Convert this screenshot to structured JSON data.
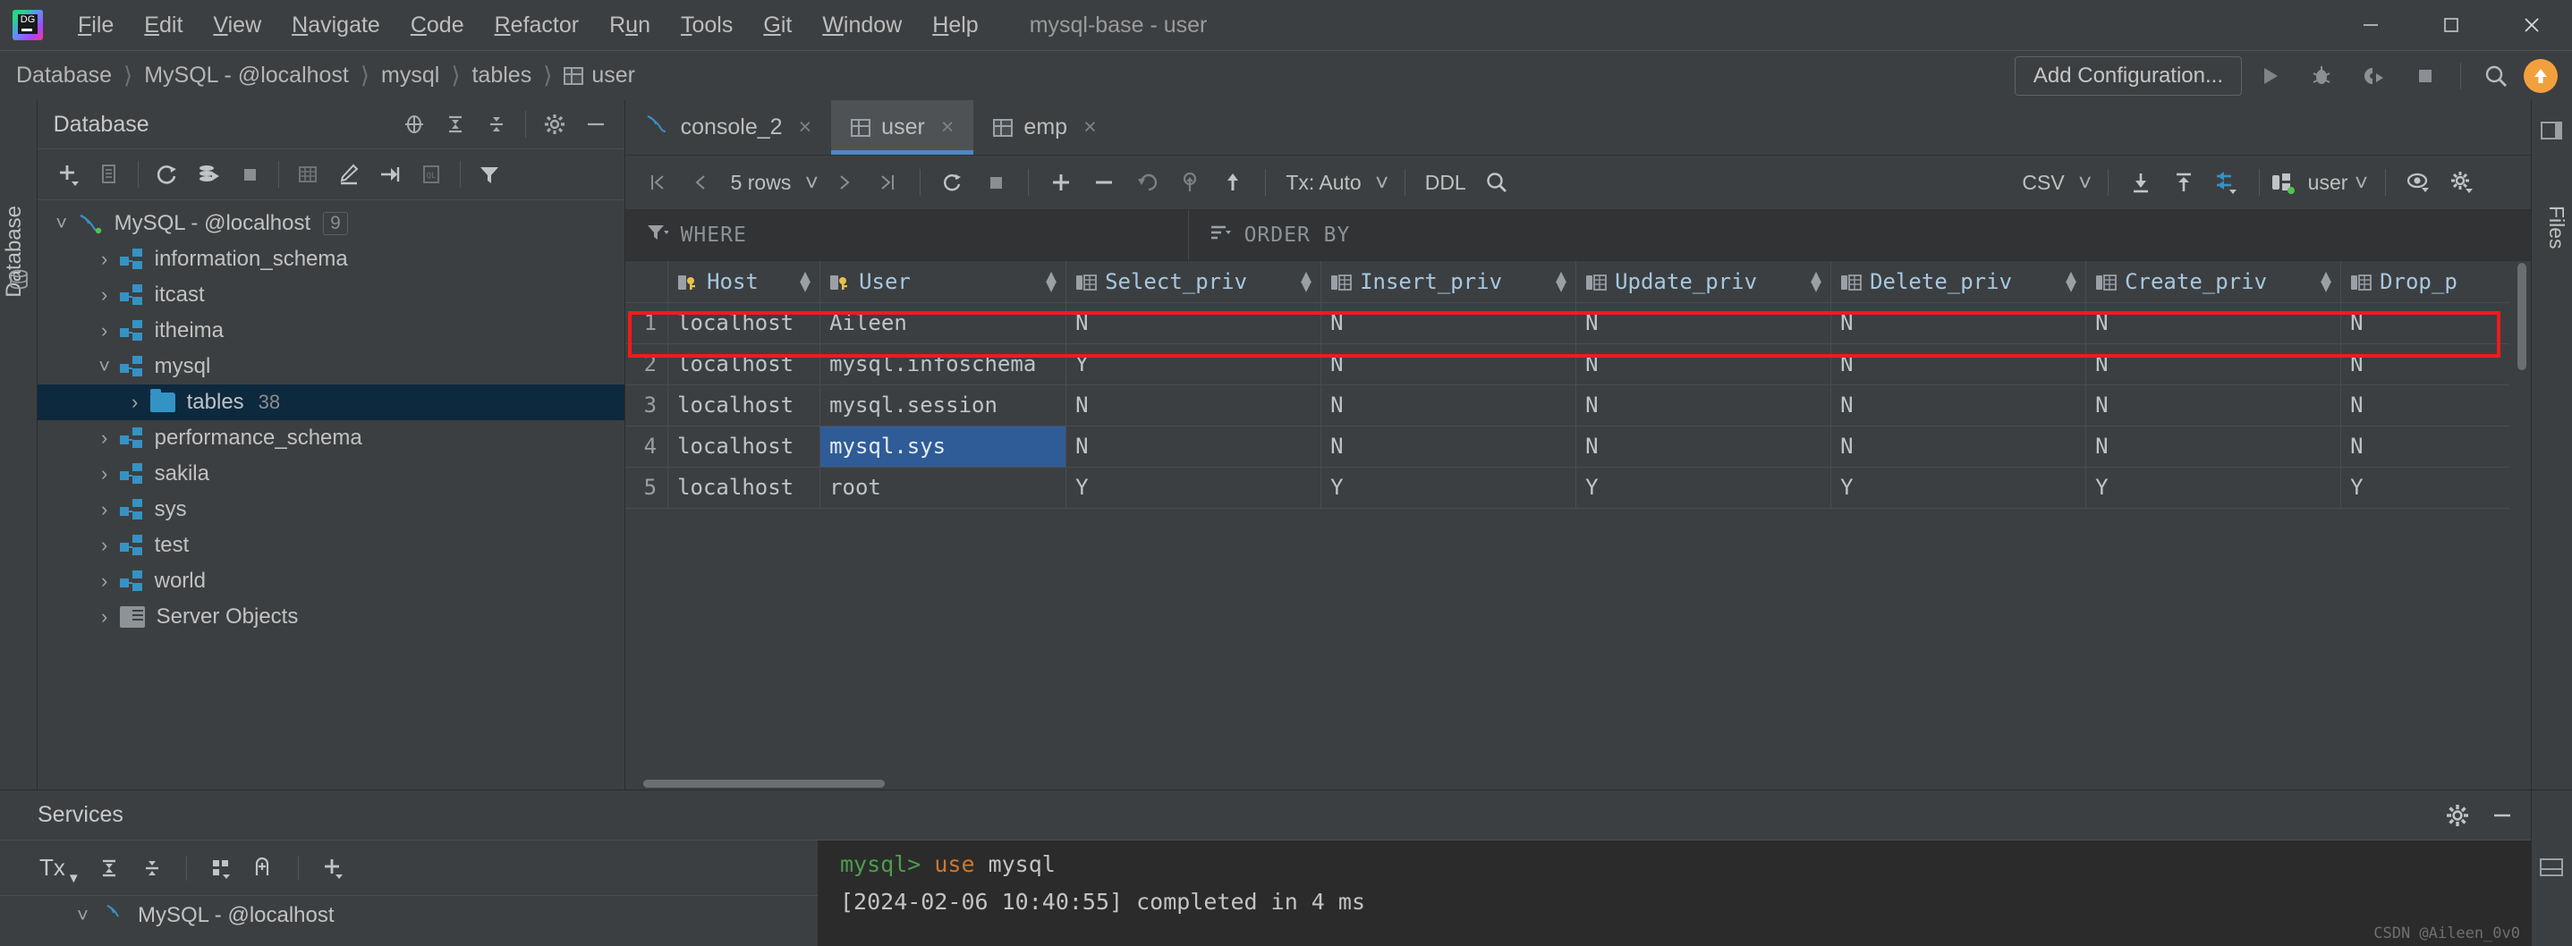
{
  "window": {
    "title": "mysql-base - user",
    "logo_text": "DG",
    "controls": {
      "minimize": "minimize-icon",
      "maximize": "maximize-icon",
      "close": "close-icon"
    }
  },
  "menubar": {
    "items": [
      {
        "label": "File",
        "mnemonic": "F"
      },
      {
        "label": "Edit",
        "mnemonic": "E"
      },
      {
        "label": "View",
        "mnemonic": "V"
      },
      {
        "label": "Navigate",
        "mnemonic": "N"
      },
      {
        "label": "Code",
        "mnemonic": "C"
      },
      {
        "label": "Refactor",
        "mnemonic": "R"
      },
      {
        "label": "Run",
        "mnemonic": "u"
      },
      {
        "label": "Tools",
        "mnemonic": "T"
      },
      {
        "label": "Git",
        "mnemonic": "G"
      },
      {
        "label": "Window",
        "mnemonic": "W"
      },
      {
        "label": "Help",
        "mnemonic": "H"
      }
    ]
  },
  "navbar": {
    "breadcrumb": [
      "Database",
      "MySQL - @localhost",
      "mysql",
      "tables",
      "user"
    ],
    "add_configuration": "Add Configuration...",
    "icons": [
      "run-icon",
      "debug-icon",
      "run-with-coverage-icon",
      "stop-icon",
      "search-everywhere-icon",
      "update-icon"
    ]
  },
  "left_strip": {
    "label": "Database",
    "icon": "database-tool-window-icon"
  },
  "right_strip": {
    "label": "Files",
    "icon": "collapse-icon"
  },
  "database_panel": {
    "title": "Database",
    "header_icons": [
      "locate-icon",
      "expand-all-icon",
      "collapse-all-icon",
      "settings-icon",
      "hide-icon"
    ],
    "toolbar_icons": [
      "add-icon",
      "duplicate-icon",
      "refresh-icon",
      "run-sql-icon",
      "stop-icon",
      "table-editor-icon",
      "modify-icon",
      "jump-to-icon",
      "query-console-icon",
      "filter-icon"
    ],
    "tree": [
      {
        "label": "MySQL - @localhost",
        "badge": "9",
        "indent": 0,
        "expanded": true,
        "icon": "mysql-dolphin-icon",
        "selected": false
      },
      {
        "label": "information_schema",
        "indent": 1,
        "expanded": false,
        "icon": "schema-icon",
        "selected": false
      },
      {
        "label": "itcast",
        "indent": 1,
        "expanded": false,
        "icon": "schema-icon",
        "selected": false
      },
      {
        "label": "itheima",
        "indent": 1,
        "expanded": false,
        "icon": "schema-icon",
        "selected": false
      },
      {
        "label": "mysql",
        "indent": 1,
        "expanded": true,
        "icon": "schema-icon",
        "selected": false
      },
      {
        "label": "tables",
        "count": "38",
        "indent": 2,
        "expanded": false,
        "icon": "folder-icon",
        "selected": true
      },
      {
        "label": "performance_schema",
        "indent": 1,
        "expanded": false,
        "icon": "schema-icon",
        "selected": false
      },
      {
        "label": "sakila",
        "indent": 1,
        "expanded": false,
        "icon": "schema-icon",
        "selected": false
      },
      {
        "label": "sys",
        "indent": 1,
        "expanded": false,
        "icon": "schema-icon",
        "selected": false
      },
      {
        "label": "test",
        "indent": 1,
        "expanded": false,
        "icon": "schema-icon",
        "selected": false
      },
      {
        "label": "world",
        "indent": 1,
        "expanded": false,
        "icon": "schema-icon",
        "selected": false
      },
      {
        "label": "Server Objects",
        "indent": 1,
        "expanded": false,
        "icon": "server-objects-icon",
        "selected": false
      }
    ]
  },
  "editor": {
    "tabs": [
      {
        "label": "console_2",
        "icon": "mysql-dolphin-icon",
        "active": false,
        "close": "×"
      },
      {
        "label": "user",
        "icon": "table-icon",
        "active": true,
        "close": "×"
      },
      {
        "label": "emp",
        "icon": "table-icon",
        "active": false,
        "close": "×"
      }
    ],
    "grid_toolbar": {
      "rows_label": "5 rows",
      "tx_label": "Tx: Auto",
      "ddl_label": "DDL",
      "export_format": "CSV",
      "schema_selector": "user",
      "left_icons": [
        "first-page-icon",
        "prev-page-icon",
        "next-page-icon",
        "last-page-icon",
        "reload-icon",
        "stop-icon",
        "add-row-icon",
        "delete-row-icon",
        "revert-icon",
        "rollback-icon",
        "submit-icon",
        "search-icon"
      ],
      "right_icons": [
        "export-to-file-icon",
        "import-icon",
        "data-extractor-icon",
        "view-options-icon",
        "settings-icon"
      ]
    },
    "filter_bar": {
      "where_label": "WHERE",
      "where_value": "",
      "order_by_label": "ORDER BY",
      "order_by_value": "",
      "where_icon": "filter-icon",
      "order_icon": "sort-icon"
    },
    "table": {
      "row_number_header": "",
      "columns": [
        {
          "name": "Host",
          "icon": "primary-key-icon"
        },
        {
          "name": "User",
          "icon": "primary-key-icon"
        },
        {
          "name": "Select_priv",
          "icon": "column-icon"
        },
        {
          "name": "Insert_priv",
          "icon": "column-icon"
        },
        {
          "name": "Update_priv",
          "icon": "column-icon"
        },
        {
          "name": "Delete_priv",
          "icon": "column-icon"
        },
        {
          "name": "Create_priv",
          "icon": "column-icon"
        },
        {
          "name": "Drop_p",
          "icon": "column-icon"
        }
      ],
      "rows": [
        {
          "n": "1",
          "cells": [
            "localhost",
            "Aileen",
            "N",
            "N",
            "N",
            "N",
            "N",
            "N"
          ],
          "highlighted": true
        },
        {
          "n": "2",
          "cells": [
            "localhost",
            "mysql.infoschema",
            "Y",
            "N",
            "N",
            "N",
            "N",
            "N"
          ]
        },
        {
          "n": "3",
          "cells": [
            "localhost",
            "mysql.session",
            "N",
            "N",
            "N",
            "N",
            "N",
            "N"
          ]
        },
        {
          "n": "4",
          "cells": [
            "localhost",
            "mysql.sys",
            "N",
            "N",
            "N",
            "N",
            "N",
            "N"
          ],
          "selected_cell_index": 1
        },
        {
          "n": "5",
          "cells": [
            "localhost",
            "root",
            "Y",
            "Y",
            "Y",
            "Y",
            "Y",
            "Y"
          ]
        }
      ],
      "highlight_color": "#f01b1b",
      "selection_color": "#2f5c97"
    }
  },
  "services": {
    "title": "Services",
    "header_icons": [
      "settings-icon",
      "hide-icon"
    ],
    "toolbar_label": "Tx",
    "toolbar_icons": [
      "tx-icon",
      "expand-all-icon",
      "collapse-all-icon",
      "group-icon",
      "open-in-new-icon",
      "add-icon"
    ],
    "tree": [
      {
        "label": "MySQL - @localhost",
        "icon": "mysql-dolphin-icon",
        "expanded": true
      }
    ],
    "console_lines": [
      {
        "segments": [
          {
            "text": "mysql> ",
            "color": "#4c9e4c"
          },
          {
            "text": "use ",
            "color": "#cc7832"
          },
          {
            "text": "mysql",
            "color": "#c3c3c3"
          }
        ]
      },
      {
        "segments": [
          {
            "text": "[2024-02-06 10:40:55] completed in 4 ms",
            "color": "#c3c3c3"
          }
        ]
      }
    ],
    "watermark": "CSDN @Aileen_0v0"
  }
}
